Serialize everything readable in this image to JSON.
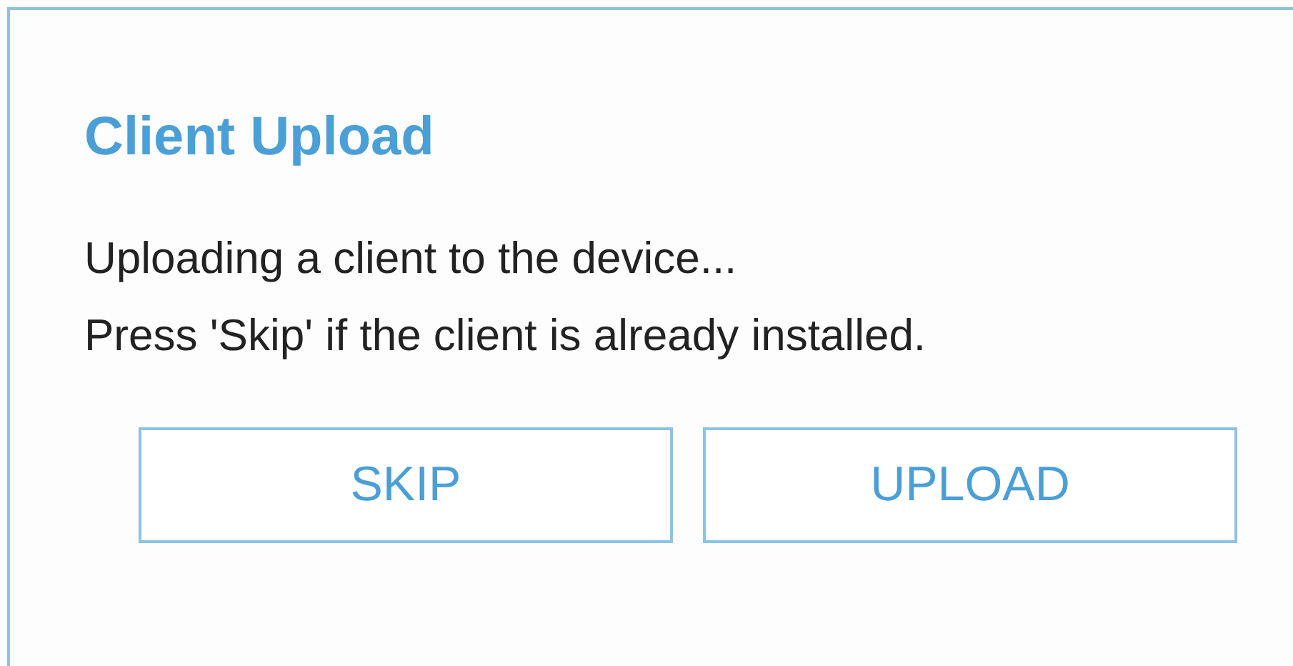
{
  "dialog": {
    "title": "Client Upload",
    "message": [
      "Uploading a client to the device...",
      "Press 'Skip' if the client is already installed."
    ],
    "buttons": [
      {
        "label": "SKIP"
      },
      {
        "label": "UPLOAD"
      }
    ]
  }
}
